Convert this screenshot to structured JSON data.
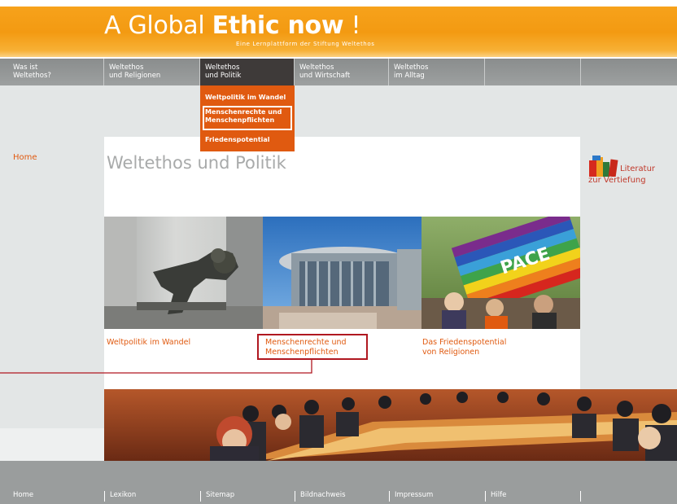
{
  "header": {
    "logo_plain": "A Global ",
    "logo_bold": "Ethic now",
    "logo_suffix": " !",
    "tagline": "Eine Lernplattform der Stiftung Weltethos"
  },
  "nav": {
    "items": [
      {
        "line1": "Was ist",
        "line2": "Weltethos?"
      },
      {
        "line1": "Weltethos",
        "line2": "und Religionen"
      },
      {
        "line1": "Weltethos",
        "line2": "und Politik"
      },
      {
        "line1": "Weltethos",
        "line2": "und Wirtschaft"
      },
      {
        "line1": "Weltethos",
        "line2": "im Alltag"
      }
    ]
  },
  "submenu": {
    "items": [
      "Weltpolitik im Wandel",
      {
        "line1": "Menschenrechte und",
        "line2": "Menschenpflichten"
      },
      "Friedenspotential"
    ]
  },
  "sidebar": {
    "home": "Home"
  },
  "page": {
    "title": "Weltethos und Politik"
  },
  "right": {
    "line1": "Literatur",
    "line2": "zur Vertiefung"
  },
  "tiles": [
    {
      "line1": "Weltpolitik im Wandel",
      "line2": ""
    },
    {
      "line1": "Menschenrechte und",
      "line2": "Menschenpflichten"
    },
    {
      "line1": "Das Friedenspotential",
      "line2": "von Religionen"
    }
  ],
  "flag_text": "PACE",
  "footer": [
    "Home",
    "Lexikon",
    "Sitemap",
    "Bildnachweis",
    "Impressum",
    "Hilfe"
  ],
  "colors": {
    "orange": "#f39a12",
    "accent": "#e05a10",
    "nav": "#9a9d9d",
    "highlight": "#b01820"
  }
}
